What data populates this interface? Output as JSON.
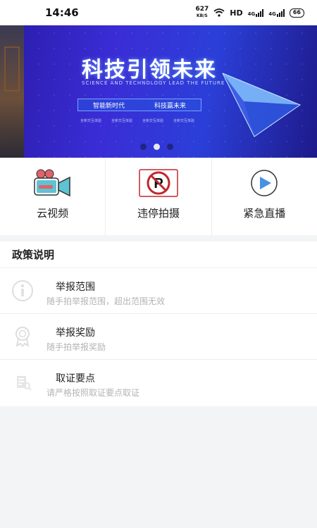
{
  "status_bar": {
    "time": "14:46",
    "speed_value": "627",
    "speed_unit": "KB/S",
    "network_label": "HD",
    "signal_1": "4G",
    "signal_2": "4G",
    "battery": "66"
  },
  "banner": {
    "headline": "科技引领未来",
    "subtitle": "SCIENCE AND TECHNOLOGY LEAD THE FUTURE",
    "tag_left": "智能新时代",
    "tag_right": "科技赢未来",
    "links": [
      "全新交互体验",
      "全新交互体验",
      "全新交互体验",
      "全新交互体验"
    ],
    "page_count": 3,
    "active_page": 2
  },
  "quick_menu": [
    {
      "label": "云视频",
      "icon": "video-camera-icon"
    },
    {
      "label": "违停拍摄",
      "icon": "no-parking-icon"
    },
    {
      "label": "紧急直播",
      "icon": "play-icon"
    }
  ],
  "policy": {
    "title": "政策说明",
    "items": [
      {
        "title": "举报范围",
        "desc": "随手拍举报范围，超出范围无效",
        "icon": "info-icon"
      },
      {
        "title": "举报奖励",
        "desc": "随手拍举报奖励",
        "icon": "award-icon"
      },
      {
        "title": "取证要点",
        "desc": "请严格按照取证要点取证",
        "icon": "document-icon"
      }
    ]
  },
  "colors": {
    "banner_blue": "#3a2dd6",
    "camera_red": "#e0626a",
    "camera_teal": "#5ec3d3",
    "no_parking_red": "#c0282e",
    "play_blue": "#4a90e2"
  }
}
